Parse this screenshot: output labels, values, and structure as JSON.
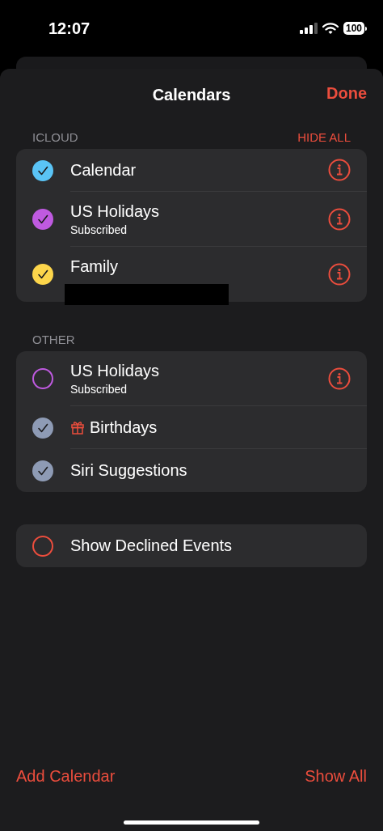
{
  "status_bar": {
    "time": "12:07",
    "battery": "100"
  },
  "sheet": {
    "title": "Calendars",
    "done": "Done"
  },
  "sections": [
    {
      "header": "ICLOUD",
      "action": "HIDE ALL",
      "items": [
        {
          "kind": "plain",
          "name": "Calendar",
          "checked": true,
          "color": "#5ac4f6",
          "info": true,
          "redacted": false
        },
        {
          "kind": "plain",
          "name": "US Holidays",
          "subtitle": "Subscribed",
          "checked": true,
          "color": "#bf5ae0",
          "info": true,
          "redacted": false
        },
        {
          "kind": "plain",
          "name": "Family",
          "checked": true,
          "color": "#fdd64b",
          "info": true,
          "redacted": true
        }
      ]
    },
    {
      "header": "OTHER",
      "items": [
        {
          "kind": "plain",
          "name": "US Holidays",
          "subtitle": "Subscribed",
          "checked": false,
          "color": "#bf5ae0",
          "info": true,
          "redacted": false
        },
        {
          "kind": "gift",
          "name": "Birthdays",
          "checked": true,
          "color": "#8e9bb5",
          "info": false,
          "redacted": false
        },
        {
          "kind": "plain",
          "name": "Siri Suggestions",
          "checked": true,
          "color": "#8e9bb5",
          "info": false,
          "redacted": false
        }
      ]
    },
    {
      "items": [
        {
          "kind": "plain",
          "name": "Show Declined Events",
          "checked": false,
          "color": "#eb4d3d",
          "info": false,
          "redacted": false
        }
      ]
    }
  ],
  "footer": {
    "left": "Add Calendar",
    "right": "Show All"
  }
}
